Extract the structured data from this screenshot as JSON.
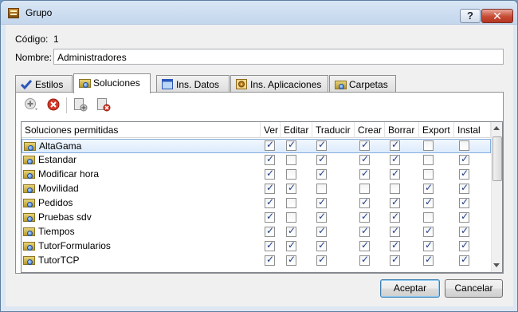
{
  "window": {
    "title": "Grupo",
    "help_symbol": "?",
    "close_symbol": "✕"
  },
  "form": {
    "codigo_label": "Código:",
    "codigo_value": "1",
    "nombre_label": "Nombre:",
    "nombre_value": "Administradores"
  },
  "tabs": [
    {
      "label": "Estilos",
      "icon": "check-icon",
      "active": false
    },
    {
      "label": "Soluciones",
      "icon": "folder-globe-icon",
      "active": true
    },
    {
      "label": "Ins. Datos",
      "icon": "window-icon",
      "active": false
    },
    {
      "label": "Ins. Aplicaciones",
      "icon": "gear-icon",
      "active": false
    },
    {
      "label": "Carpetas",
      "icon": "folder-globe-icon",
      "active": false
    }
  ],
  "toolbar": {
    "add_icon": "add-circle-icon",
    "delete_icon": "delete-circle-icon",
    "add_all_icon": "add-page-icon",
    "remove_all_icon": "remove-page-icon"
  },
  "grid": {
    "columns": [
      "Soluciones permitidas",
      "Ver",
      "Editar",
      "Traducir",
      "Crear",
      "Borrar",
      "Export",
      "Instal"
    ],
    "rows": [
      {
        "name": "AltaGama",
        "selected": true,
        "checks": [
          1,
          1,
          1,
          1,
          1,
          0,
          0
        ]
      },
      {
        "name": "Estandar",
        "selected": false,
        "checks": [
          1,
          0,
          1,
          1,
          1,
          0,
          1
        ]
      },
      {
        "name": "Modificar hora",
        "selected": false,
        "checks": [
          1,
          0,
          1,
          1,
          1,
          0,
          1
        ]
      },
      {
        "name": "Movilidad",
        "selected": false,
        "checks": [
          1,
          1,
          0,
          0,
          0,
          1,
          1
        ]
      },
      {
        "name": "Pedidos",
        "selected": false,
        "checks": [
          1,
          0,
          1,
          1,
          1,
          1,
          1
        ]
      },
      {
        "name": "Pruebas sdv",
        "selected": false,
        "checks": [
          1,
          0,
          1,
          1,
          1,
          0,
          1
        ]
      },
      {
        "name": "Tiempos",
        "selected": false,
        "checks": [
          1,
          1,
          1,
          1,
          1,
          1,
          1
        ]
      },
      {
        "name": "TutorFormularios",
        "selected": false,
        "checks": [
          1,
          1,
          1,
          1,
          1,
          1,
          1
        ]
      },
      {
        "name": "TutorTCP",
        "selected": false,
        "checks": [
          1,
          1,
          1,
          1,
          1,
          1,
          1
        ]
      }
    ]
  },
  "buttons": {
    "accept": "Aceptar",
    "cancel": "Cancelar"
  },
  "colors": {
    "selection": "#dcebfc",
    "close_button": "#c64a33"
  }
}
